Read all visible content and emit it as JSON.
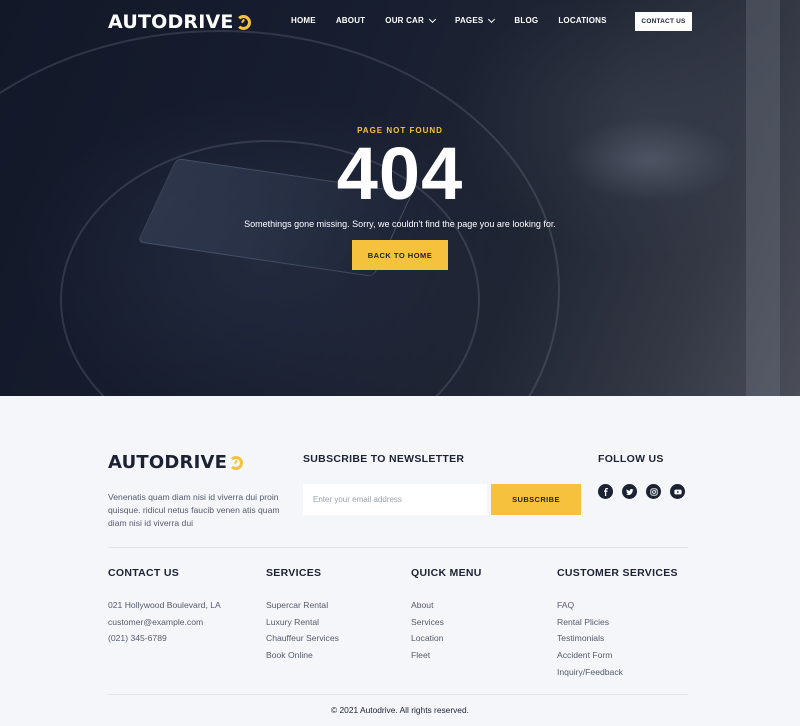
{
  "brand": {
    "name": "AUTODRIVE",
    "accent": "#f6c23e",
    "dark": "#1b2233"
  },
  "nav": {
    "items": [
      {
        "label": "HOME",
        "dropdown": false
      },
      {
        "label": "ABOUT",
        "dropdown": false
      },
      {
        "label": "OUR CAR",
        "dropdown": true
      },
      {
        "label": "PAGES",
        "dropdown": true
      },
      {
        "label": "BLOG",
        "dropdown": false
      },
      {
        "label": "LOCATIONS",
        "dropdown": false
      }
    ],
    "contact_label": "CONTACT US"
  },
  "hero": {
    "eyebrow": "PAGE NOT FOUND",
    "code": "404",
    "message": "Somethings gone missing. Sorry, we couldn't find the page you are looking for.",
    "button_label": "BACK TO HOME"
  },
  "footer": {
    "about": "Venenatis quam diam nisi id viverra dui proin quisque. ridicul netus faucib venen atis quam diam nisi id viverra dui",
    "newsletter": {
      "title": "SUBSCRIBE TO NEWSLETTER",
      "placeholder": "Enter your email address",
      "button_label": "SUBSCRIBE"
    },
    "follow": {
      "title": "FOLLOW US",
      "icons": [
        "facebook-icon",
        "twitter-icon",
        "instagram-icon",
        "youtube-icon"
      ]
    },
    "contact": {
      "title": "CONTACT US",
      "items": [
        "021 Hollywood Boulevard, LA",
        "customer@example.com",
        "(021) 345-6789"
      ]
    },
    "services": {
      "title": "SERVICES",
      "items": [
        "Supercar Rental",
        "Luxury Rental",
        "Chauffeur Services",
        "Book Online"
      ]
    },
    "quick_menu": {
      "title": "QUICK MENU",
      "items": [
        "About",
        "Services",
        "Location",
        "Fleet"
      ]
    },
    "customer_services": {
      "title": "CUSTOMER SERVICES",
      "items": [
        "FAQ",
        "Rental Plicies",
        "Testimonials",
        "Accident Form",
        "Inquiry/Feedback"
      ]
    },
    "copyright": "© 2021 Autodrive. All rights reserved."
  }
}
